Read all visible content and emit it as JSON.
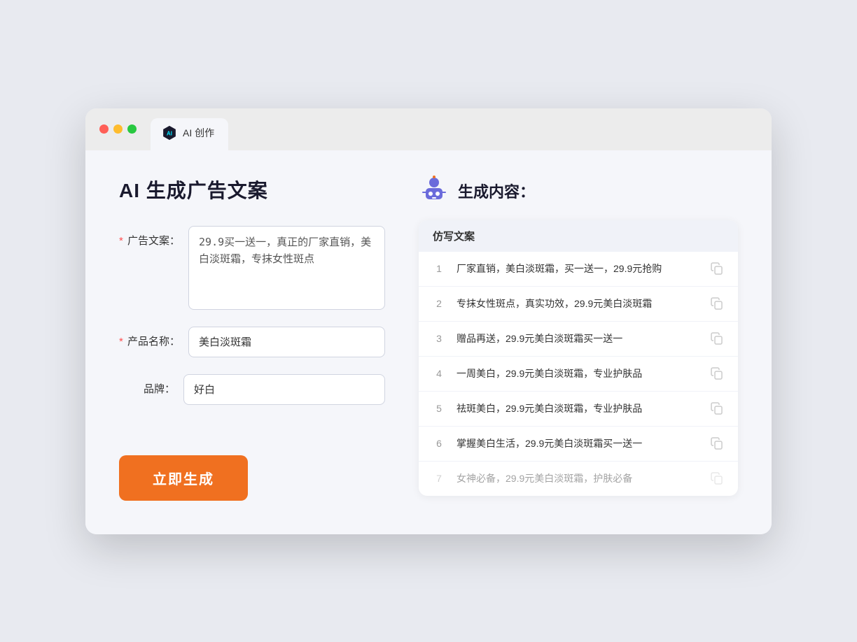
{
  "browser": {
    "tab_label": "AI 创作"
  },
  "left": {
    "page_title": "AI 生成广告文案",
    "fields": [
      {
        "id": "ad_copy",
        "label": "广告文案：",
        "required": true,
        "type": "textarea",
        "value": "29.9买一送一，真正的厂家直销，美白淡斑霜，专抹女性斑点"
      },
      {
        "id": "product_name",
        "label": "产品名称：",
        "required": true,
        "type": "input",
        "value": "美白淡斑霜"
      },
      {
        "id": "brand",
        "label": "品牌：",
        "required": false,
        "type": "input",
        "value": "好白"
      }
    ],
    "generate_btn": "立即生成"
  },
  "right": {
    "title": "生成内容：",
    "results_header": "仿写文案",
    "results": [
      {
        "num": "1",
        "text": "厂家直销，美白淡斑霜，买一送一，29.9元抢购",
        "dimmed": false
      },
      {
        "num": "2",
        "text": "专抹女性斑点，真实功效，29.9元美白淡斑霜",
        "dimmed": false
      },
      {
        "num": "3",
        "text": "赠品再送，29.9元美白淡斑霜买一送一",
        "dimmed": false
      },
      {
        "num": "4",
        "text": "一周美白，29.9元美白淡斑霜，专业护肤品",
        "dimmed": false
      },
      {
        "num": "5",
        "text": "祛斑美白，29.9元美白淡斑霜，专业护肤品",
        "dimmed": false
      },
      {
        "num": "6",
        "text": "掌握美白生活，29.9元美白淡斑霜买一送一",
        "dimmed": false
      },
      {
        "num": "7",
        "text": "女神必备，29.9元美白淡斑霜，护肤必备",
        "dimmed": true
      }
    ]
  }
}
